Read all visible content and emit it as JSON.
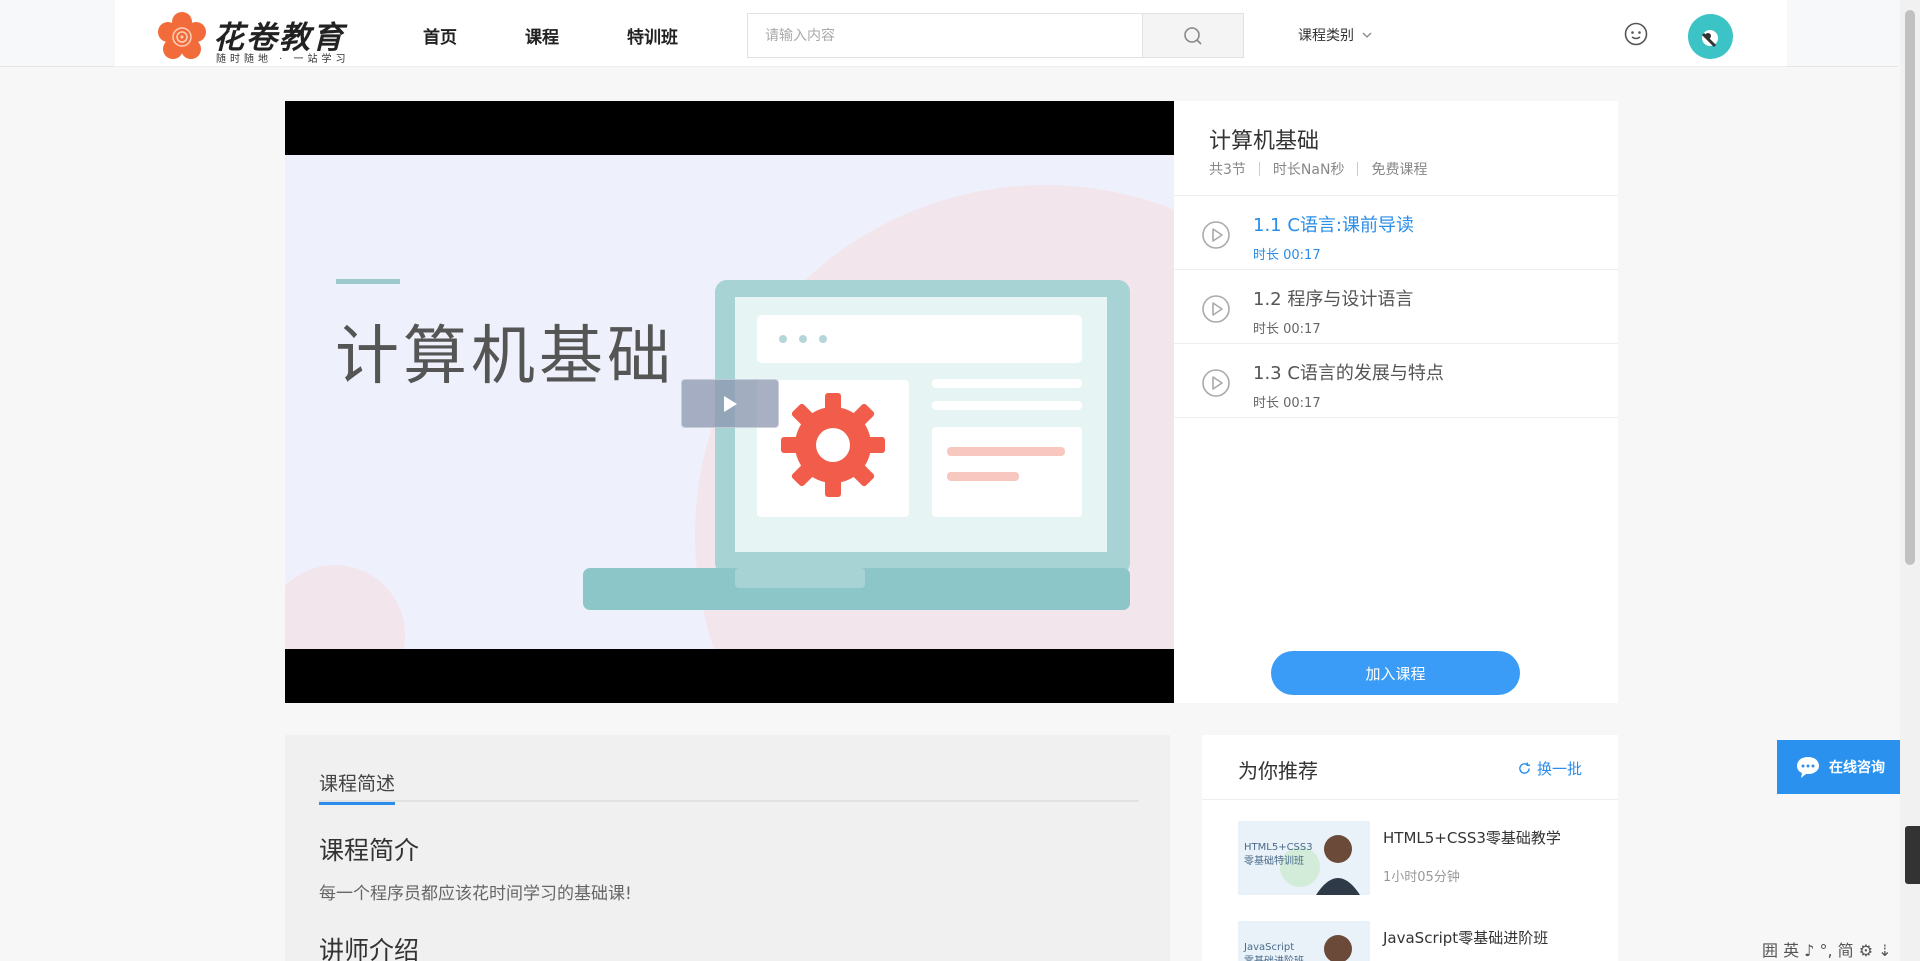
{
  "header": {
    "logo_title": "花卷教育",
    "logo_subtitle": "随时随地 · 一站学习",
    "nav": [
      "首页",
      "课程",
      "特训班"
    ],
    "search_placeholder": "请输入内容",
    "category_label": "课程类别"
  },
  "player": {
    "poster_title": "计算机基础"
  },
  "course": {
    "title": "计算机基础",
    "lesson_count": "共3节",
    "duration": "时长NaN秒",
    "price": "免费课程",
    "lessons": [
      {
        "title": "1.1 C语言:课前导读",
        "duration": "时长 00:17"
      },
      {
        "title": "1.2 程序与设计语言",
        "duration": "时长 00:17"
      },
      {
        "title": "1.3 C语言的发展与特点",
        "duration": "时长 00:17"
      }
    ],
    "join_label": "加入课程"
  },
  "description": {
    "tab": "课程简述",
    "intro_heading": "课程简介",
    "intro_text": "每一个程序员都应该花时间学习的基础课!",
    "teacher_heading": "讲师介绍"
  },
  "recommend": {
    "title": "为你推荐",
    "refresh_label": "换一批",
    "items": [
      {
        "name": "HTML5+CSS3零基础教学",
        "duration": "1小时05分钟",
        "thumb_text": "HTML5+CSS3 零基础特训班"
      },
      {
        "name": "JavaScript零基础进阶班",
        "duration": "",
        "thumb_text": "JavaScript 零基础进阶班"
      }
    ]
  },
  "float": {
    "consult_label": "在线咨询"
  },
  "ime": "囲 英 ♪ °, 简 ⚙ ⇣"
}
